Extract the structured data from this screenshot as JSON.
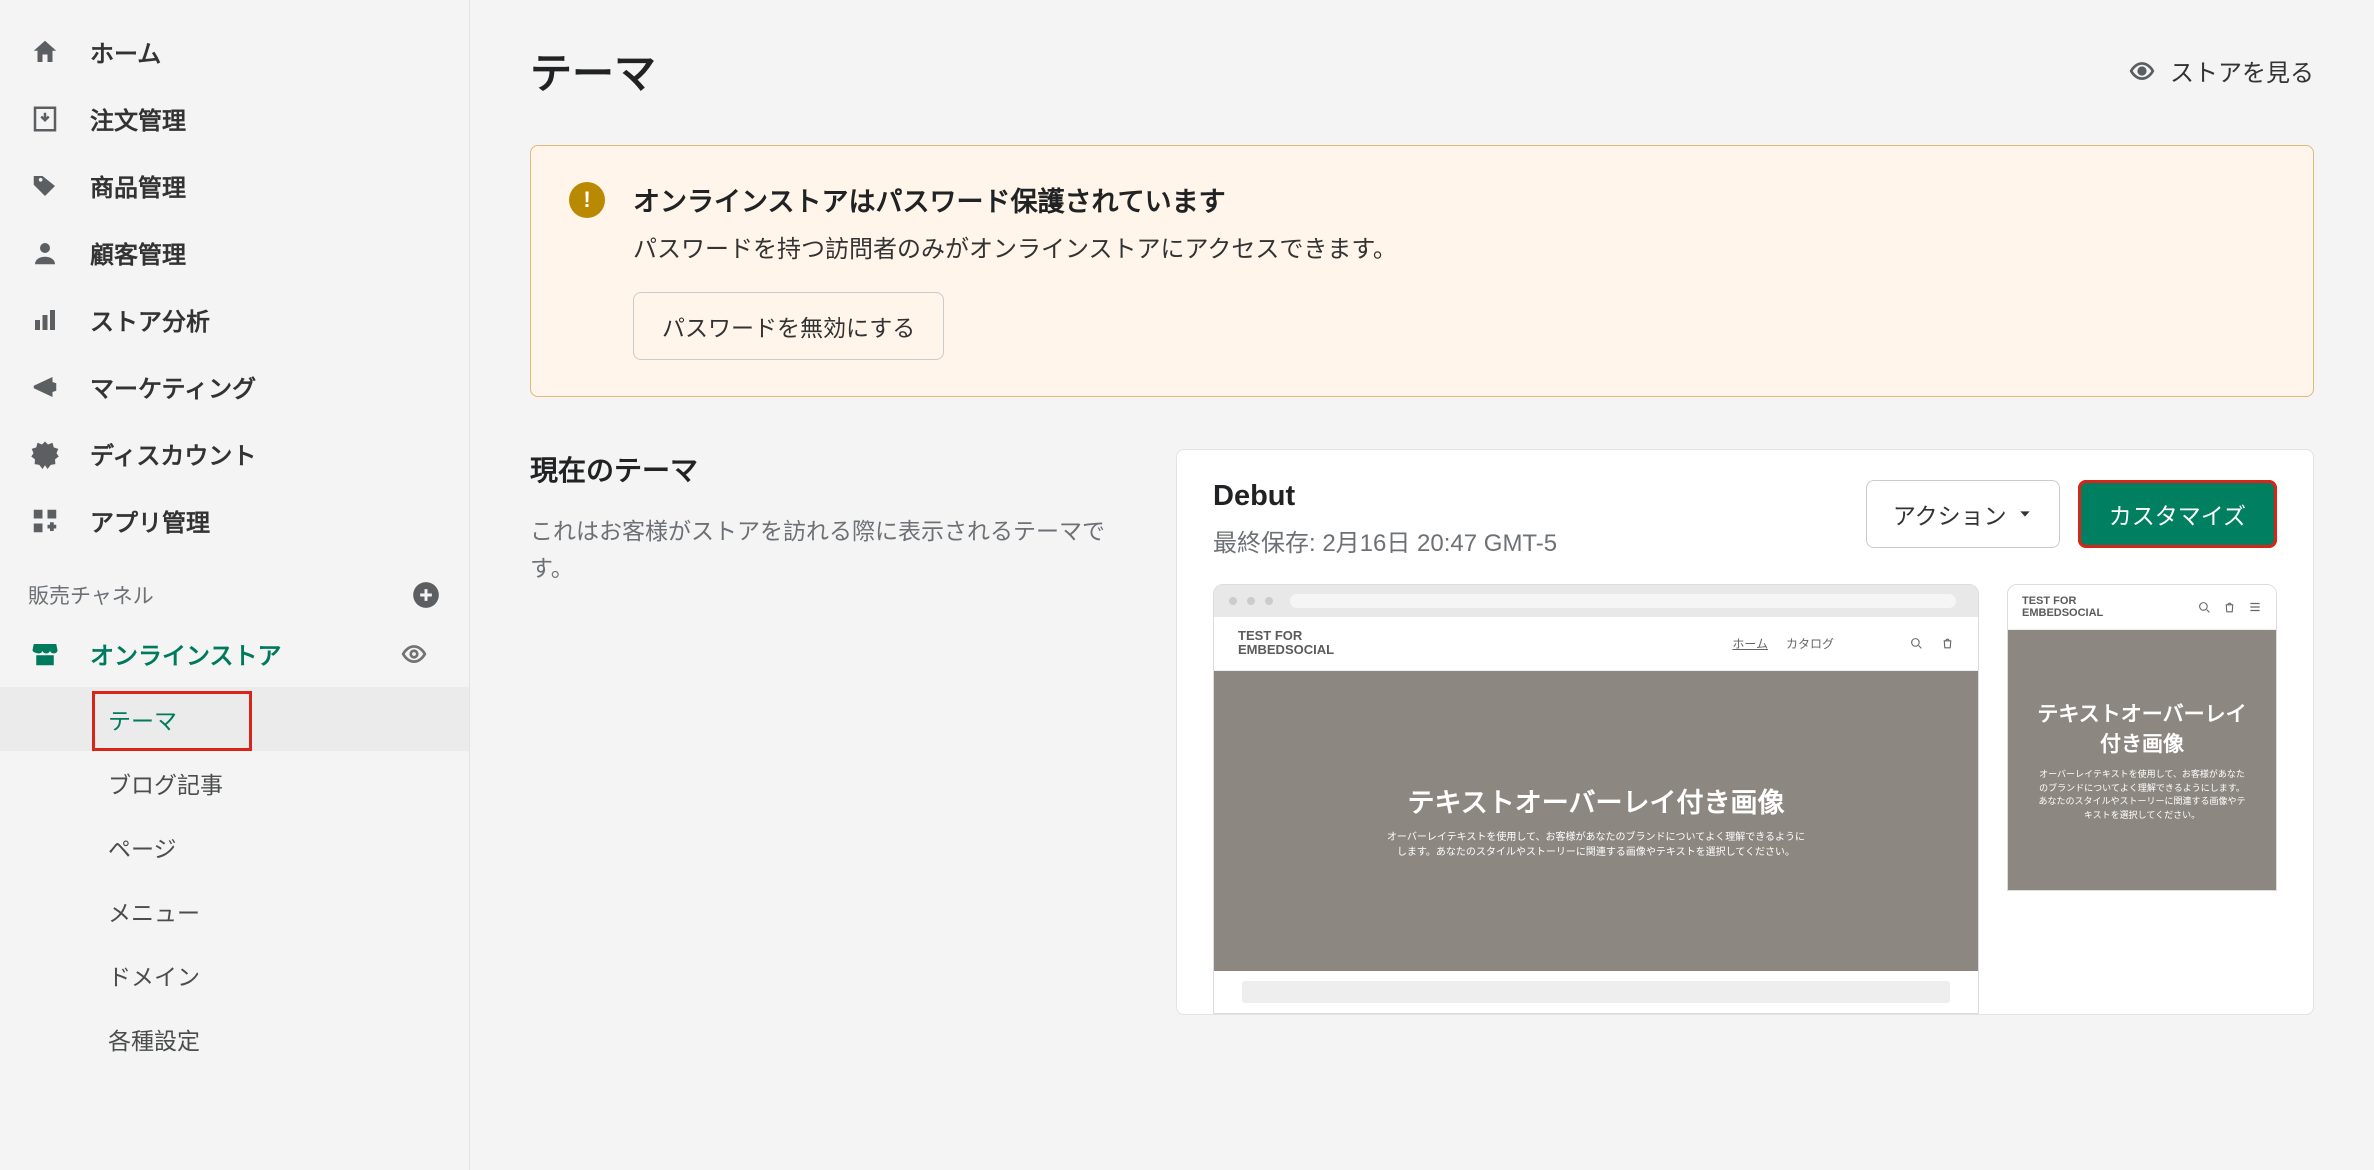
{
  "sidebar": {
    "items": [
      {
        "label": "ホーム",
        "icon": "home-icon"
      },
      {
        "label": "注文管理",
        "icon": "orders-icon"
      },
      {
        "label": "商品管理",
        "icon": "products-icon"
      },
      {
        "label": "顧客管理",
        "icon": "customers-icon"
      },
      {
        "label": "ストア分析",
        "icon": "analytics-icon"
      },
      {
        "label": "マーケティング",
        "icon": "marketing-icon"
      },
      {
        "label": "ディスカウント",
        "icon": "discounts-icon"
      },
      {
        "label": "アプリ管理",
        "icon": "apps-icon"
      }
    ],
    "channels_label": "販売チャネル",
    "online_store_label": "オンラインストア",
    "sub_items": [
      "テーマ",
      "ブログ記事",
      "ページ",
      "メニュー",
      "ドメイン",
      "各種設定"
    ]
  },
  "header": {
    "title": "テーマ",
    "view_store": "ストアを見る"
  },
  "banner": {
    "title": "オンラインストアはパスワード保護されています",
    "body": "パスワードを持つ訪問者のみがオンラインストアにアクセスできます。",
    "button": "パスワードを無効にする"
  },
  "current_theme": {
    "heading": "現在のテーマ",
    "description": "これはお客様がストアを訪れる際に表示されるテーマです。"
  },
  "theme_card": {
    "name": "Debut",
    "last_saved": "最終保存: 2月16日 20:47 GMT-5",
    "actions_label": "アクション",
    "customize_label": "カスタマイズ"
  },
  "preview": {
    "logo_line1": "TEST FOR",
    "logo_line2": "EMBEDSOCIAL",
    "nav_home": "ホーム",
    "nav_catalog": "カタログ",
    "hero_title": "テキストオーバーレイ付き画像",
    "hero_sub": "オーバーレイテキストを使用して、お客様があなたのブランドについてよく理解できるようにします。あなたのスタイルやストーリーに関連する画像やテキストを選択してください。"
  }
}
